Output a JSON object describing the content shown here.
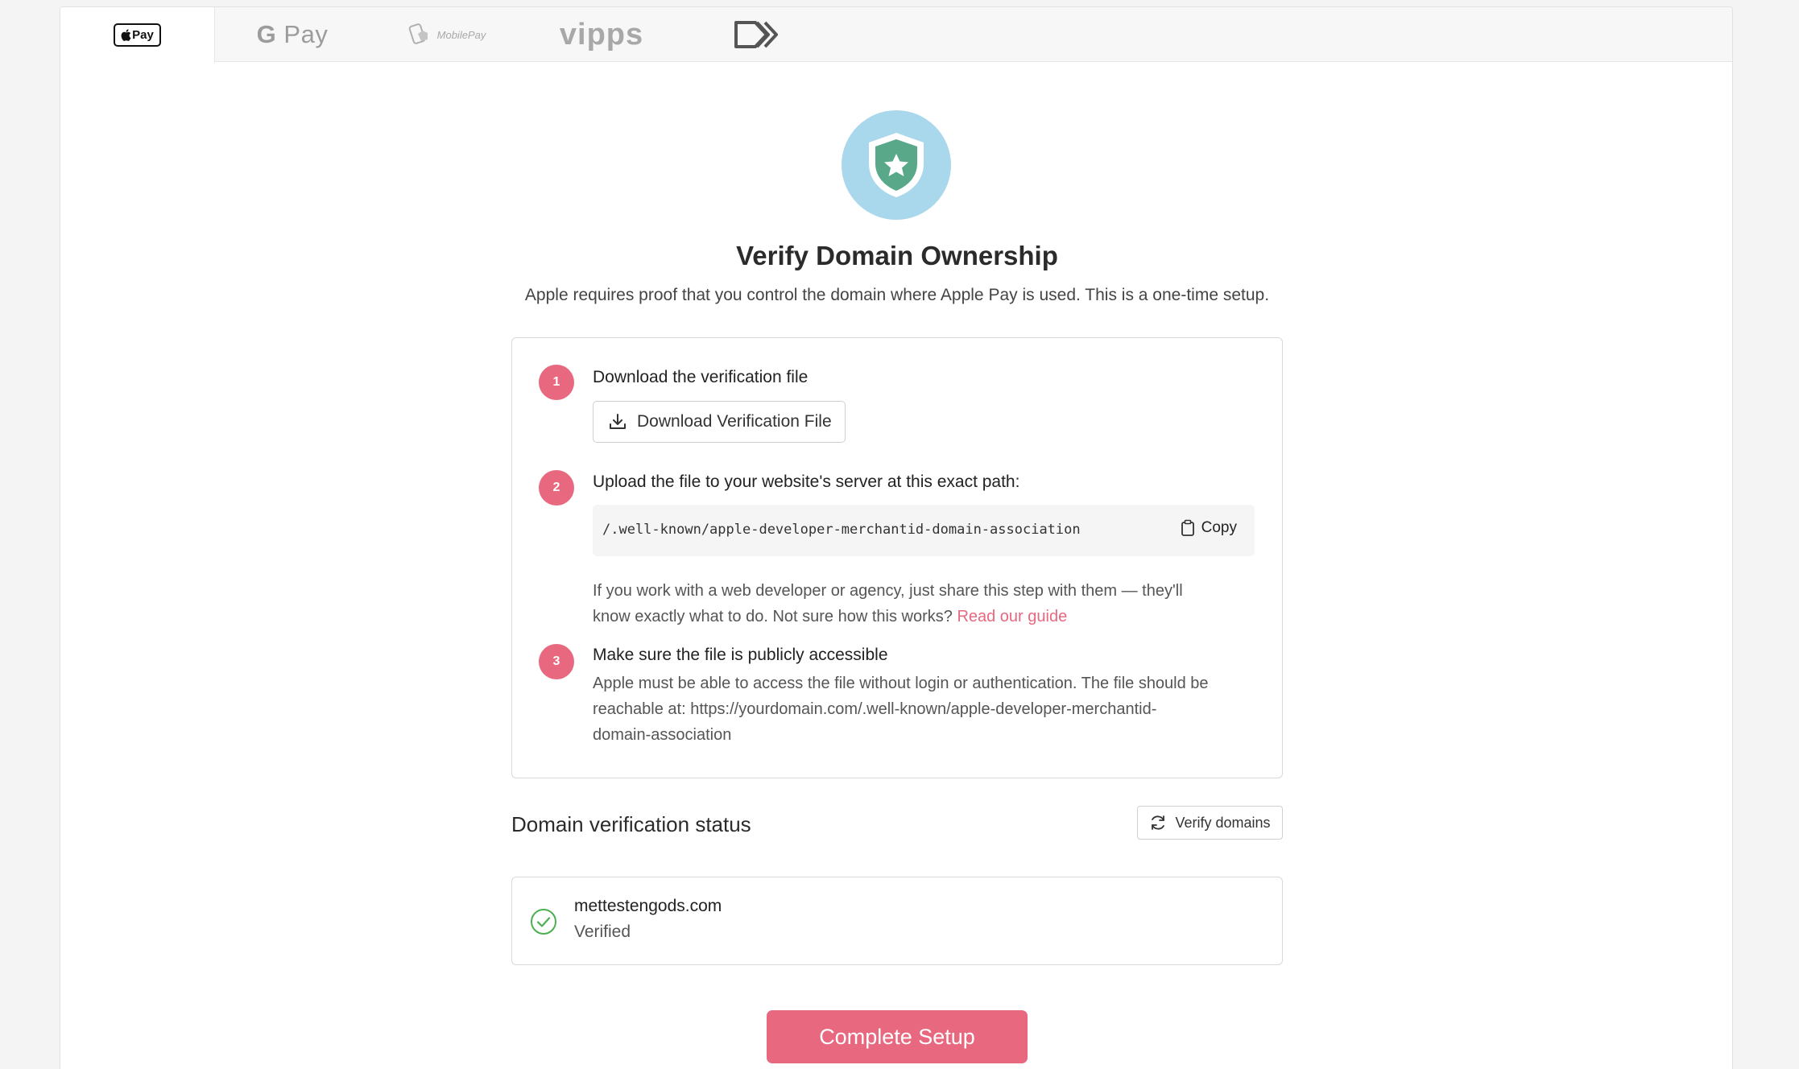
{
  "tabs": [
    {
      "label": "Pay",
      "name": "Apple Pay",
      "active": true
    },
    {
      "label": "Pay",
      "name": "Google Pay",
      "active": false
    },
    {
      "label": "MobilePay",
      "name": "MobilePay",
      "active": false
    },
    {
      "label": "vipps",
      "name": "Vipps",
      "active": false
    },
    {
      "label": "",
      "name": "Other",
      "active": false
    }
  ],
  "header": {
    "title": "Verify Domain Ownership",
    "subtitle": "Apple requires proof that you control the domain where Apple Pay is used. This is a one-time setup."
  },
  "steps": [
    {
      "number": "1",
      "title": "Download the verification file",
      "button_label": "Download Verification File"
    },
    {
      "number": "2",
      "title": "Upload the file to your website's server at this exact path:",
      "path": "/.well-known/apple-developer-merchantid-domain-association",
      "copy_label": "Copy",
      "note_line1": "If you work with a web developer or agency, just share this step with them — they'll",
      "note_line2": "know exactly what to do. Not sure how this works?",
      "note_link": "Read our guide"
    },
    {
      "number": "3",
      "title": "Make sure the file is publicly accessible",
      "desc_line1": "Apple must be able to access the file without login or authentication. The file should be",
      "desc_line2": "reachable at: https://yourdomain.com/.well-known/apple-developer-merchantid-",
      "desc_line3": "domain-association"
    }
  ],
  "status": {
    "title": "Domain verification status",
    "verify_label": "Verify domains",
    "domains": [
      {
        "name": "mettestengods.com",
        "status": "Verified"
      }
    ]
  },
  "footer": {
    "complete_label": "Complete Setup"
  },
  "colors": {
    "accent": "#e8687f",
    "hero_bg": "#a9d7eb",
    "shield": "#5aa88a",
    "verified": "#4caf50"
  }
}
